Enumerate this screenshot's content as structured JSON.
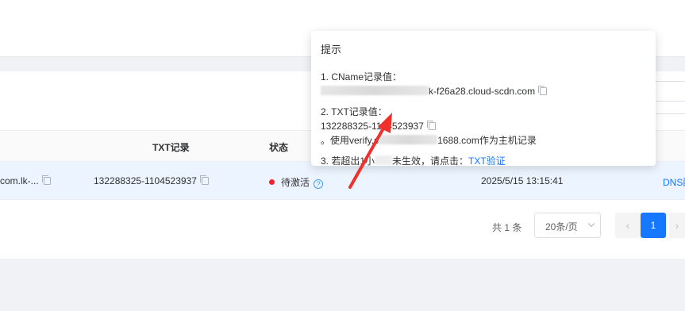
{
  "table": {
    "headers": {
      "txt": "TXT记录",
      "status": "状态"
    },
    "row": {
      "cname_fragment": "com.lk-...",
      "txt_value": "132288325-1104523937",
      "status": "待激活",
      "created": "2025/5/15 13:15:41",
      "action_fragment": "DNS配"
    }
  },
  "pagination": {
    "total": "共 1 条",
    "page_size": "20条/页",
    "prev": "‹",
    "current": "1",
    "next": "›"
  },
  "popover": {
    "title": "提示",
    "line1_label": "1. CName记录值：",
    "line1_value_tail": "k-f26a28.cloud-scdn.com",
    "line2_label": "2. TXT记录值：",
    "line2_value": "132288325-1104523937",
    "line2_hint_prefix": "。使用verify.s",
    "line2_hint_mid": "1688.com作为主机记录",
    "line3_prefix": "3. 若超出1小",
    "line3_mid": "未生效，请点击：",
    "line3_link": "TXT验证"
  },
  "colors": {
    "accent": "#1677ff",
    "status_dot": "#f5222d",
    "annotation_arrow": "#f0302c"
  }
}
